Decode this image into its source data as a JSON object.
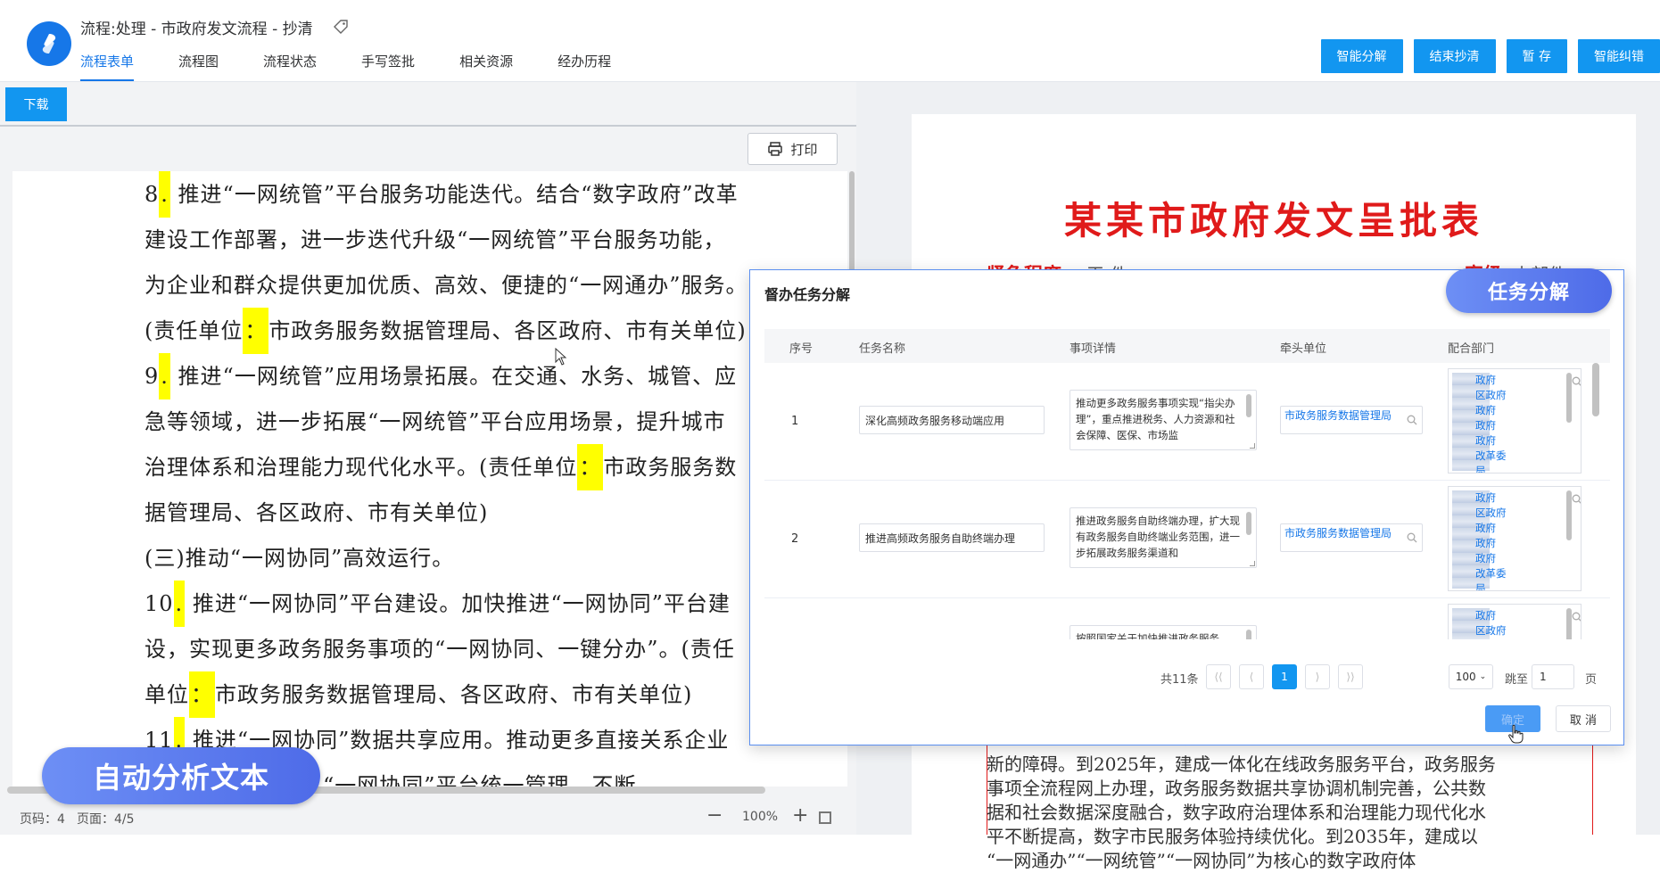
{
  "header": {
    "title": "流程:处理 - 市政府发文流程 - 抄清",
    "tabs": [
      {
        "label": "流程表单"
      },
      {
        "label": "流程图"
      },
      {
        "label": "流程状态"
      },
      {
        "label": "手写签批"
      },
      {
        "label": "相关资源"
      },
      {
        "label": "经办历程"
      }
    ],
    "buttons": [
      {
        "label": "智能分解"
      },
      {
        "label": "结束抄清"
      },
      {
        "label": "暂 存"
      },
      {
        "label": "智能纠错"
      }
    ]
  },
  "left": {
    "download_label": "下载",
    "print_label": "打印",
    "lines": [
      {
        "parts": [
          "8",
          ".",
          " 推进“一网统管”平台服务功能迭代。结合“数字政府”改革"
        ]
      },
      {
        "parts": [
          "建设工作部署，进一步迭代升级“一网统管”平台服务功能，"
        ]
      },
      {
        "parts": [
          "为企业和群众提供更加优质、高效、便捷的“一网通办”服务。"
        ]
      },
      {
        "parts": [
          "(责任单位",
          "：",
          "市政务服务数据管理局、各区政府、市有关单位)"
        ]
      },
      {
        "parts": [
          "9",
          ".",
          " 推进“一网统管”应用场景拓展。在交通、水务、城管、应"
        ]
      },
      {
        "parts": [
          "急等领域，进一步拓展“一网统管”平台应用场景，提升城市"
        ]
      },
      {
        "parts": [
          "治理体系和治理能力现代化水平。(责任单位",
          "：",
          "市政务服务数"
        ]
      },
      {
        "parts": [
          "据管理局、各区政府、市有关单位)"
        ]
      },
      {
        "parts": [
          "(三)推动“一网协同”高效运行。"
        ]
      },
      {
        "parts": [
          "10",
          ".",
          " 推进“一网协同”平台建设。加快推进“一网协同”平台建"
        ]
      },
      {
        "parts": [
          "设，实现更多政务服务事项的“一网协同、一键分办”。(责任"
        ]
      },
      {
        "parts": [
          "单位",
          "：",
          "市政务服务数据管理局、各区政府、市有关单位)"
        ]
      },
      {
        "parts": [
          "11",
          ".",
          " 推进“一网协同”数据共享应用。推动更多直接关系企业"
        ]
      },
      {
        "parts": [
          "和群众的数据纳入“一网协同”平台统一管理，不断"
        ]
      }
    ],
    "status": {
      "page_code": "页码：4",
      "page": "页面：4/5",
      "zoom": "100%",
      "minus": "−",
      "plus": "+"
    },
    "auto_analyze_label": "自动分析文本"
  },
  "form": {
    "title": "某某市政府发文呈批表",
    "urgency_label": "紧急程度",
    "urgency_value": "平 件",
    "secret_label": "密级",
    "secret_value": "内部件",
    "text_lines": [
      "新的障碍。到2025年，建成一体化在线政务服务平台，政务服务",
      "事项全流程网上办理，政务服务数据共享协调机制完善，公共数",
      "据和社会数据深度融合，数字政府治理体系和治理能力现代化水",
      "平不断提高，数字市民服务体验持续优化。到2035年，建成以",
      "“一网通办”“一网统管”“一网协同”为核心的数字政府体"
    ]
  },
  "modal": {
    "title": "督办任务分解",
    "task_button": "任务分解",
    "columns": [
      "序号",
      "任务名称",
      "事项详情",
      "牵头单位",
      "配合部门"
    ],
    "rows": [
      {
        "no": "1",
        "name": "深化高频政务服务移动端应用",
        "detail": "推动更多政务服务事项实现“指尖办理”，重点推进税务、人力资源和社会保障、医保、市场监",
        "lead": "市政务服务数据管理局",
        "depts": [
          "政府",
          "区政府",
          "政府",
          "政府",
          "政府",
          "改革委",
          "局"
        ]
      },
      {
        "no": "2",
        "name": "推进高频政务服务自助终端办理",
        "detail": "推进政务服务自助终端办理，扩大现有政务服务自助终端业务范围，进一步拓展政务服务渠道和",
        "lead": "市政务服务数据管理局",
        "depts": [
          "政府",
          "区政府",
          "政府",
          "政府",
          "政府",
          "改革委",
          "局"
        ]
      },
      {
        "no": "",
        "name": "",
        "detail": "按照国家关于加快推进政务服务",
        "lead": "",
        "depts": [
          "政府",
          "区政府",
          "政府"
        ]
      }
    ],
    "pager": {
      "total": "共11条",
      "current_page": "1",
      "page_size": "100",
      "jump_label": "跳至",
      "jump_value": "1",
      "page_label": "页",
      "first": "⟨⟨",
      "prev": "⟨",
      "next": "⟩",
      "last": "⟩⟩"
    },
    "ok_label": "确定",
    "cancel_label": "取 消"
  },
  "colors": {
    "primary": "#1296f0",
    "brand_blue": "#1677e8",
    "form_red": "#e01a1a",
    "highlight": "#ffff00"
  },
  "icons": [
    "logo-icon",
    "tag-icon",
    "print-icon",
    "search-icon",
    "fit-screen-icon",
    "cursor-icon"
  ]
}
